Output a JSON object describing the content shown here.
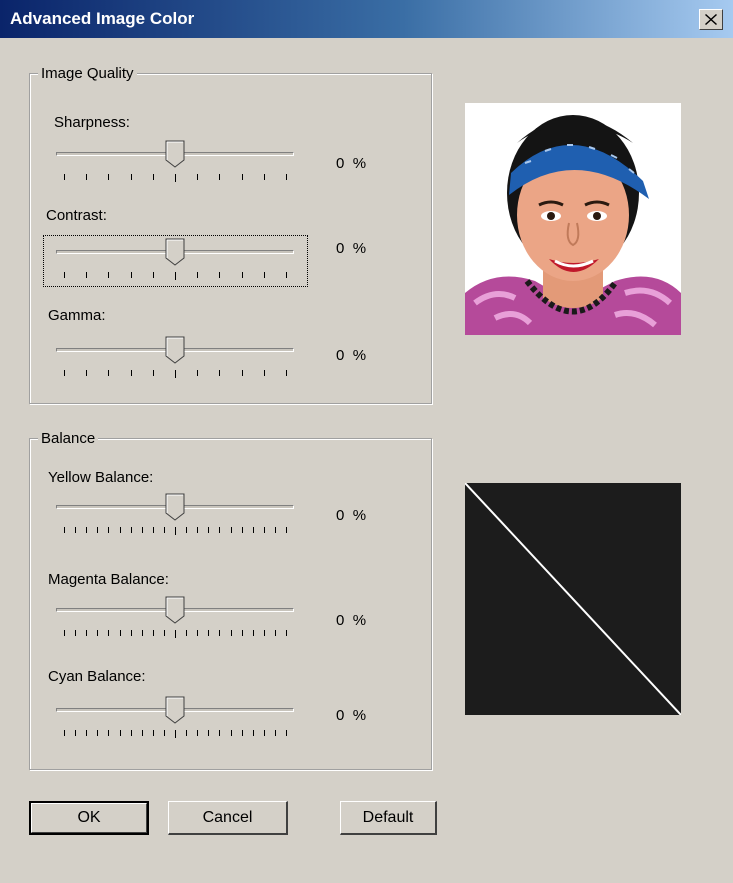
{
  "window": {
    "title": "Advanced Image Color"
  },
  "image_quality": {
    "legend": "Image Quality",
    "sliders": [
      {
        "label": "Sharpness:",
        "value": "0",
        "unit": "%",
        "position": 0.5
      },
      {
        "label": "Contrast:",
        "value": "0",
        "unit": "%",
        "position": 0.5
      },
      {
        "label": "Gamma:",
        "value": "0",
        "unit": "%",
        "position": 0.5
      }
    ]
  },
  "balance": {
    "legend": "Balance",
    "sliders": [
      {
        "label": "Yellow Balance:",
        "value": "0",
        "unit": "%",
        "position": 0.5
      },
      {
        "label": "Magenta Balance:",
        "value": "0",
        "unit": "%",
        "position": 0.5
      },
      {
        "label": "Cyan Balance:",
        "value": "0",
        "unit": "%",
        "position": 0.5
      }
    ]
  },
  "buttons": {
    "ok": "OK",
    "cancel": "Cancel",
    "default": "Default"
  },
  "colors": {
    "title_start": "#0a246a",
    "title_end": "#a6caf0",
    "dialog_bg": "#d4d0c8",
    "curve_bg": "#1c1c1c",
    "curve_line": "#ffffff",
    "headband": "#1f5fb0"
  }
}
